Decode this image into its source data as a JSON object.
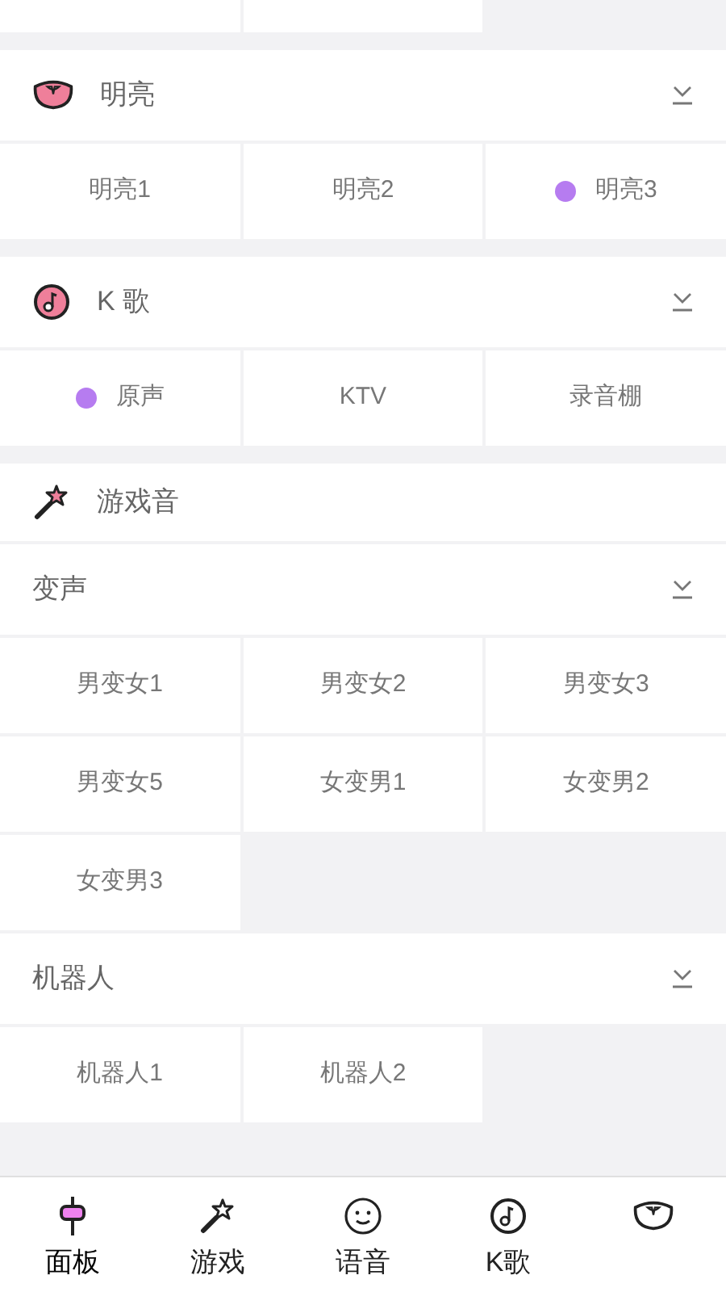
{
  "sections": [
    {
      "title": "明亮",
      "expandable": true,
      "options": [
        {
          "label": "明亮1",
          "selected": false
        },
        {
          "label": "明亮2",
          "selected": false
        },
        {
          "label": "明亮3",
          "selected": true
        }
      ]
    },
    {
      "title": "K 歌",
      "expandable": true,
      "options": [
        {
          "label": "原声",
          "selected": true
        },
        {
          "label": "KTV",
          "selected": false
        },
        {
          "label": "录音棚",
          "selected": false
        }
      ]
    },
    {
      "title": "游戏音",
      "expandable": false,
      "groups": [
        {
          "title": "变声",
          "expandable": true,
          "options": [
            {
              "label": "男变女1",
              "selected": false
            },
            {
              "label": "男变女2",
              "selected": false
            },
            {
              "label": "男变女3",
              "selected": false
            },
            {
              "label": "男变女5",
              "selected": false
            },
            {
              "label": "女变男1",
              "selected": false
            },
            {
              "label": "女变男2",
              "selected": false
            },
            {
              "label": "女变男3",
              "selected": false
            }
          ]
        },
        {
          "title": "机器人",
          "expandable": true,
          "options": [
            {
              "label": "机器人1",
              "selected": false
            },
            {
              "label": "机器人2",
              "selected": false
            }
          ]
        }
      ]
    }
  ],
  "tabs": [
    {
      "label": "面板",
      "selected": true
    },
    {
      "label": "游戏",
      "selected": false
    },
    {
      "label": "语音",
      "selected": false
    },
    {
      "label": "K歌",
      "selected": false
    },
    {
      "selected": false
    }
  ]
}
